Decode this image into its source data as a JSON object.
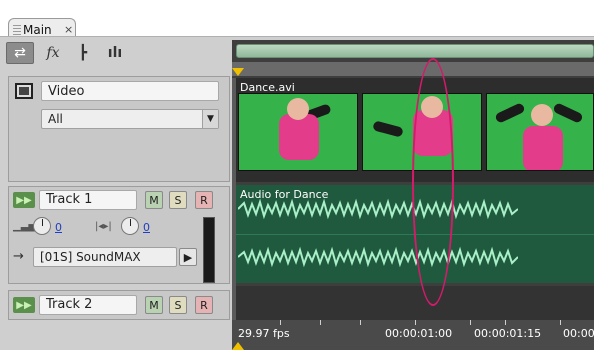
{
  "tab": {
    "label": "Main",
    "close_glyph": "×"
  },
  "toolbar": {
    "tools": [
      {
        "name": "swap-tracks-icon",
        "glyph": "⇄",
        "selected": true
      },
      {
        "name": "fx-icon",
        "glyph": "fx",
        "selected": false
      },
      {
        "name": "send-icon",
        "glyph": "┣",
        "selected": false
      },
      {
        "name": "eq-icon",
        "glyph": "ılı",
        "selected": false
      }
    ]
  },
  "video_track": {
    "name": "Video",
    "filter": "All"
  },
  "track1": {
    "name": "Track 1",
    "m": "M",
    "s": "S",
    "r": "R",
    "volume": "0",
    "pan": "0",
    "output": "[01S] SoundMAX"
  },
  "track2": {
    "name": "Track 2",
    "m": "M",
    "s": "S",
    "r": "R"
  },
  "clips": {
    "video_clip": "Dance.avi",
    "audio_clip": "Audio for Dance"
  },
  "timecode": {
    "fps": "29.97 fps",
    "marks": [
      "00:00:01:00",
      "00:00:01:15",
      "00:00"
    ]
  },
  "colors": {
    "accent_highlight": "#d51a6b",
    "playhead": "#f0c000",
    "audio_lane": "#1f5a3e",
    "video_thumb_bg": "#36b24b"
  }
}
